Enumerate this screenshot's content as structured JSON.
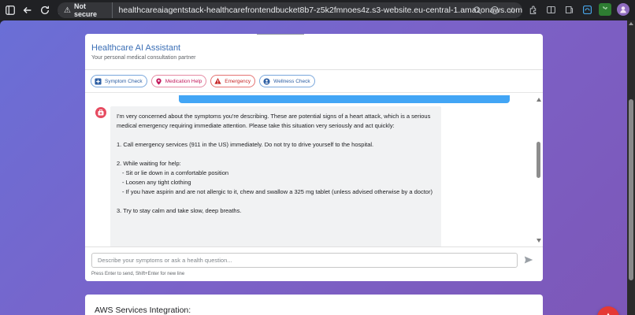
{
  "browser": {
    "security_label": "Not secure",
    "url": "healthcareaiagentstack-healthcarefrontendbucket8b7-z5k2fmnoes4z.s3-website.eu-central-1.amazonaws.com"
  },
  "assistant": {
    "title": "Healthcare AI Assistant",
    "subtitle": "Your personal medical consultation partner",
    "quick_actions": [
      {
        "label": "Symptom Check",
        "icon": "plus-square-icon",
        "color": "#2c5ea3"
      },
      {
        "label": "Medication Help",
        "icon": "pill-icon",
        "color": "#c2185b"
      },
      {
        "label": "Emergency",
        "icon": "warning-icon",
        "color": "#c62828"
      },
      {
        "label": "Wellness Check",
        "icon": "person-icon",
        "color": "#2c5ea3"
      }
    ]
  },
  "chat": {
    "bot_message": {
      "intro": "I'm very concerned about the symptoms you're describing. These are potential signs of a heart attack, which is a serious medical emergency requiring immediate attention. Please take this situation very seriously and act quickly:",
      "step1": "1. Call emergency services (911 in the US) immediately. Do not try to drive yourself to the hospital.",
      "step2": "2. While waiting for help:",
      "step2_items": [
        "- Sit or lie down in a comfortable position",
        "- Loosen any tight clothing",
        "- If you have aspirin and are not allergic to it, chew and swallow a 325 mg tablet (unless advised otherwise by a doctor)"
      ],
      "step3": "3. Try to stay calm and take slow, deep breaths."
    }
  },
  "input": {
    "placeholder": "Describe your symptoms or ask a health question...",
    "hint": "Press Enter to send, Shift+Enter for new line"
  },
  "aws": {
    "title": "AWS Services Integration:"
  },
  "colors": {
    "accent": "#3b6fb6",
    "user_bubble": "#42a5f5",
    "emergency": "#e53935"
  }
}
